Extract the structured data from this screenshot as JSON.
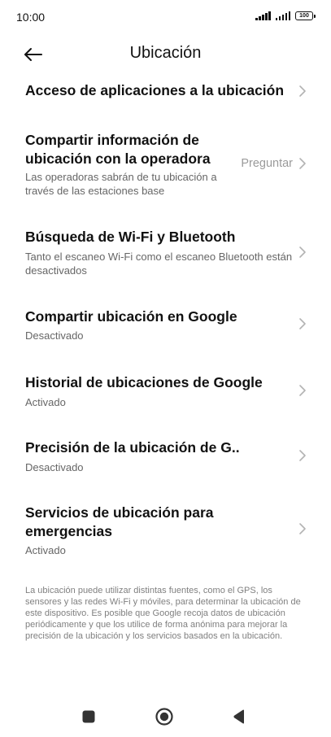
{
  "status_bar": {
    "time": "10:00",
    "battery": "100"
  },
  "header": {
    "title": "Ubicación",
    "back_icon": "arrow-left-icon"
  },
  "settings": [
    {
      "title": "Acceso de aplicaciones a la ubicación",
      "subtitle": "",
      "value": ""
    },
    {
      "title": "Compartir información de ubicación con la operadora",
      "subtitle": "Las operadoras sabrán de tu ubicación a través de las estaciones base",
      "value": "Preguntar"
    },
    {
      "title": "Búsqueda de Wi-Fi y Bluetooth",
      "subtitle": "Tanto el escaneo Wi-Fi como el escaneo Bluetooth están desactivados",
      "value": ""
    },
    {
      "title": "Compartir ubicación en Google",
      "subtitle": "Desactivado",
      "value": ""
    },
    {
      "title": "Historial de ubicaciones de Google",
      "subtitle": "Activado",
      "value": ""
    },
    {
      "title": "Precisión de la ubicación de G..",
      "subtitle": "Desactivado",
      "value": ""
    },
    {
      "title": "Servicios de ubicación para emergencias",
      "subtitle": "Activado",
      "value": ""
    }
  ],
  "footer_note": "La ubicación puede utilizar distintas fuentes, como el GPS, los sensores y las redes Wi-Fi y móviles, para determinar la ubicación de este dispositivo. Es posible que Google recoja datos de ubicación periódicamente y que los utilice de forma anónima para mejorar la precisión de la ubicación y los servicios basados en la ubicación.",
  "nav": {
    "recents_icon": "square-icon",
    "home_icon": "circle-icon",
    "back_icon": "triangle-back-icon",
    "color": "#333333"
  }
}
